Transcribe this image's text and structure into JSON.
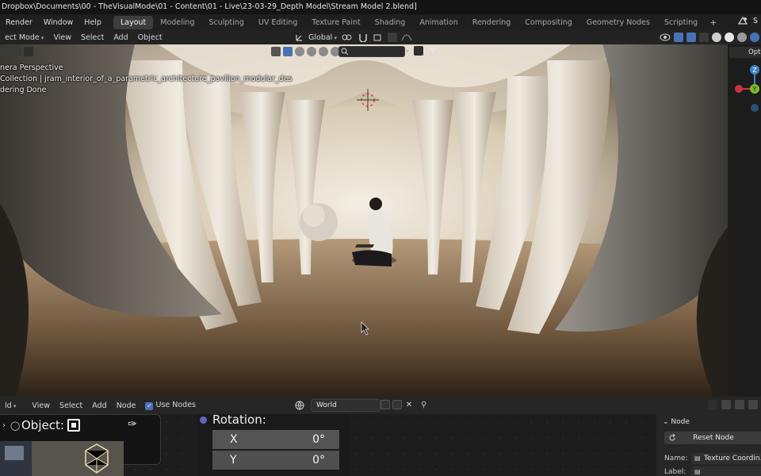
{
  "window": {
    "title": "Dropbox\\Documents\\00 - TheVisualMode\\01 - Content\\01 - Live\\23-03-29_Depth Model\\Stream Model 2.blend]"
  },
  "menubar": {
    "items": [
      "Render",
      "Window",
      "Help"
    ],
    "workspaces": [
      "Layout",
      "Modeling",
      "Sculpting",
      "UV Editing",
      "Texture Paint",
      "Shading",
      "Animation",
      "Rendering",
      "Compositing",
      "Geometry Nodes",
      "Scripting"
    ],
    "active_workspace": "Layout",
    "add_workspace": "+",
    "scene_label": "S"
  },
  "viewport_header": {
    "mode": "ect Mode",
    "menus": [
      "View",
      "Select",
      "Add",
      "Object"
    ],
    "transform_orientation": "Global"
  },
  "viewport": {
    "overlay_lines": [
      "nera Perspective",
      "Collection | jram_interior_of_a_parametric_architecture_pavilion_modular_des",
      "dering Done"
    ],
    "sidebar_tab": "Opti",
    "gizmo_axes": [
      "Z",
      "Y"
    ],
    "colors": {
      "x_axis": "#c4353f",
      "y_axis": "#7cb92b",
      "z_axis": "#3f84c8"
    }
  },
  "node_header": {
    "editor": "ld",
    "menus": [
      "View",
      "Select",
      "Add",
      "Node"
    ],
    "use_nodes_label": "Use Nodes",
    "use_nodes_checked": true,
    "world_name": "World"
  },
  "node_editor": {
    "object_node": {
      "label": "Object:"
    },
    "rotation_node": {
      "title": "Rotation:",
      "fields": [
        {
          "axis": "X",
          "value": "0°"
        },
        {
          "axis": "Y",
          "value": "0°"
        }
      ]
    }
  },
  "node_panel": {
    "section": "Node",
    "reset_label": "Reset Node",
    "name_label": "Name:",
    "name_value": "Texture Coordin...",
    "label_label": "Label:"
  },
  "accent": "#4772b3"
}
